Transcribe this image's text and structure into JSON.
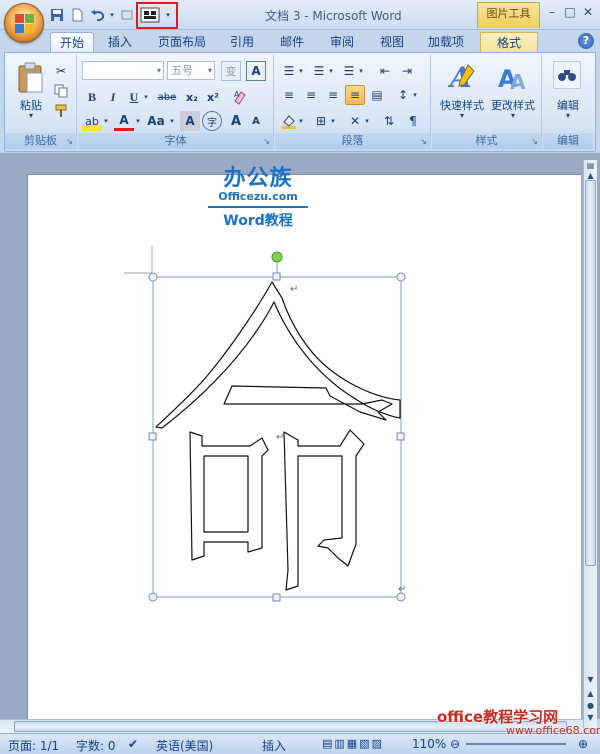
{
  "window": {
    "title": "文档 3 - Microsoft Word",
    "contextual_tab_group": "图片工具",
    "controls": [
      "–",
      "□",
      "✕"
    ]
  },
  "tabs": [
    "开始",
    "插入",
    "页面布局",
    "引用",
    "邮件",
    "审阅",
    "视图",
    "加载项",
    "格式"
  ],
  "ribbon": {
    "clipboard": {
      "label": "剪贴板",
      "paste": "粘贴"
    },
    "font": {
      "label": "字体",
      "font_name": "",
      "font_size": "五号",
      "bold": "B",
      "italic": "I",
      "underline": "U",
      "strike": "abe",
      "subscript": "x₂",
      "superscript": "x²",
      "grow": "A",
      "shrink": "A",
      "case": "Aa",
      "font_color": "A",
      "highlight": "ab",
      "phonetic": "变",
      "enclose": "字",
      "char_border": "A"
    },
    "paragraph": {
      "label": "段落"
    },
    "styles": {
      "label": "样式",
      "quick_styles": "快速样式",
      "change_styles": "更改样式"
    },
    "editing": {
      "label": "编辑"
    }
  },
  "watermark": {
    "brand": "办公族",
    "url": "Officezu.com",
    "subtitle": "Word教程",
    "footer": "office教程学习网",
    "footer_url": "www.office68.com"
  },
  "status": {
    "page": "页面: 1/1",
    "words": "字数: 0",
    "language": "英语(美国)",
    "mode": "插入",
    "zoom": "110%"
  },
  "colors": {
    "ribbon_bg": "#dbe8f7",
    "accent_blue": "#15428b",
    "contextual_yellow": "#f0cf5c",
    "highlight_red": "#e3191b"
  }
}
